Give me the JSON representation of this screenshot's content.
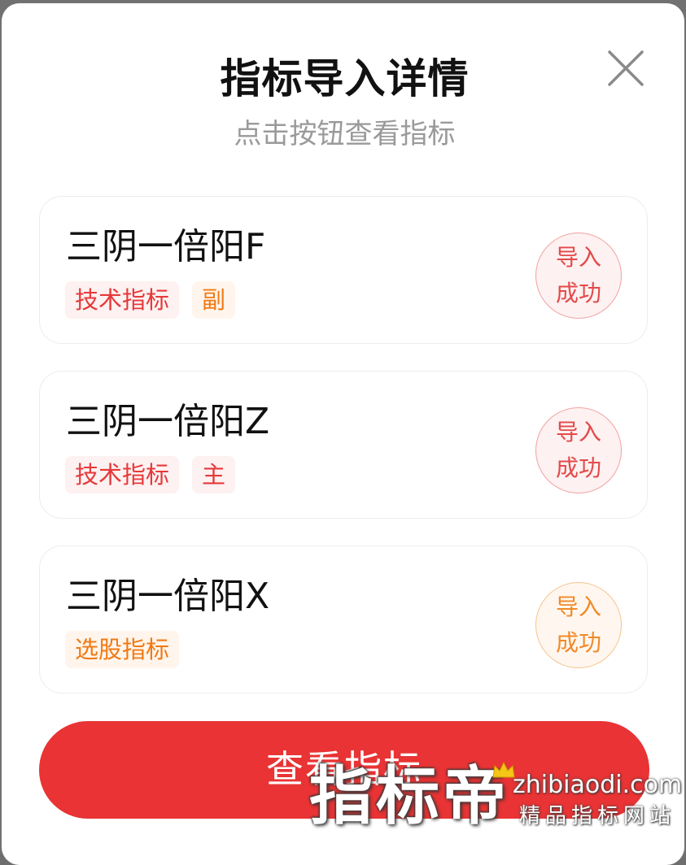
{
  "dialog": {
    "title": "指标导入详情",
    "subtitle": "点击按钮查看指标",
    "close_icon": "close-icon"
  },
  "indicators": [
    {
      "name": "三阴一倍阳F",
      "tags": [
        {
          "label": "技术指标",
          "tone": "red"
        },
        {
          "label": "副",
          "tone": "orange"
        }
      ],
      "status": [
        "导入",
        "成功"
      ],
      "status_tone": "red"
    },
    {
      "name": "三阴一倍阳Z",
      "tags": [
        {
          "label": "技术指标",
          "tone": "red"
        },
        {
          "label": "主",
          "tone": "red"
        }
      ],
      "status": [
        "导入",
        "成功"
      ],
      "status_tone": "red"
    },
    {
      "name": "三阴一倍阳X",
      "tags": [
        {
          "label": "选股指标",
          "tone": "orange"
        }
      ],
      "status": [
        "导入",
        "成功"
      ],
      "status_tone": "orange"
    }
  ],
  "action": {
    "view_label": "查看指标"
  },
  "watermark": {
    "brand": "指标帝",
    "url": "zhibiaodi.com",
    "tagline": "精品指标网站"
  },
  "colors": {
    "primary_red": "#e93334",
    "tag_red": "#e6393a",
    "tag_orange": "#f07a14",
    "overlay": "#717171"
  }
}
